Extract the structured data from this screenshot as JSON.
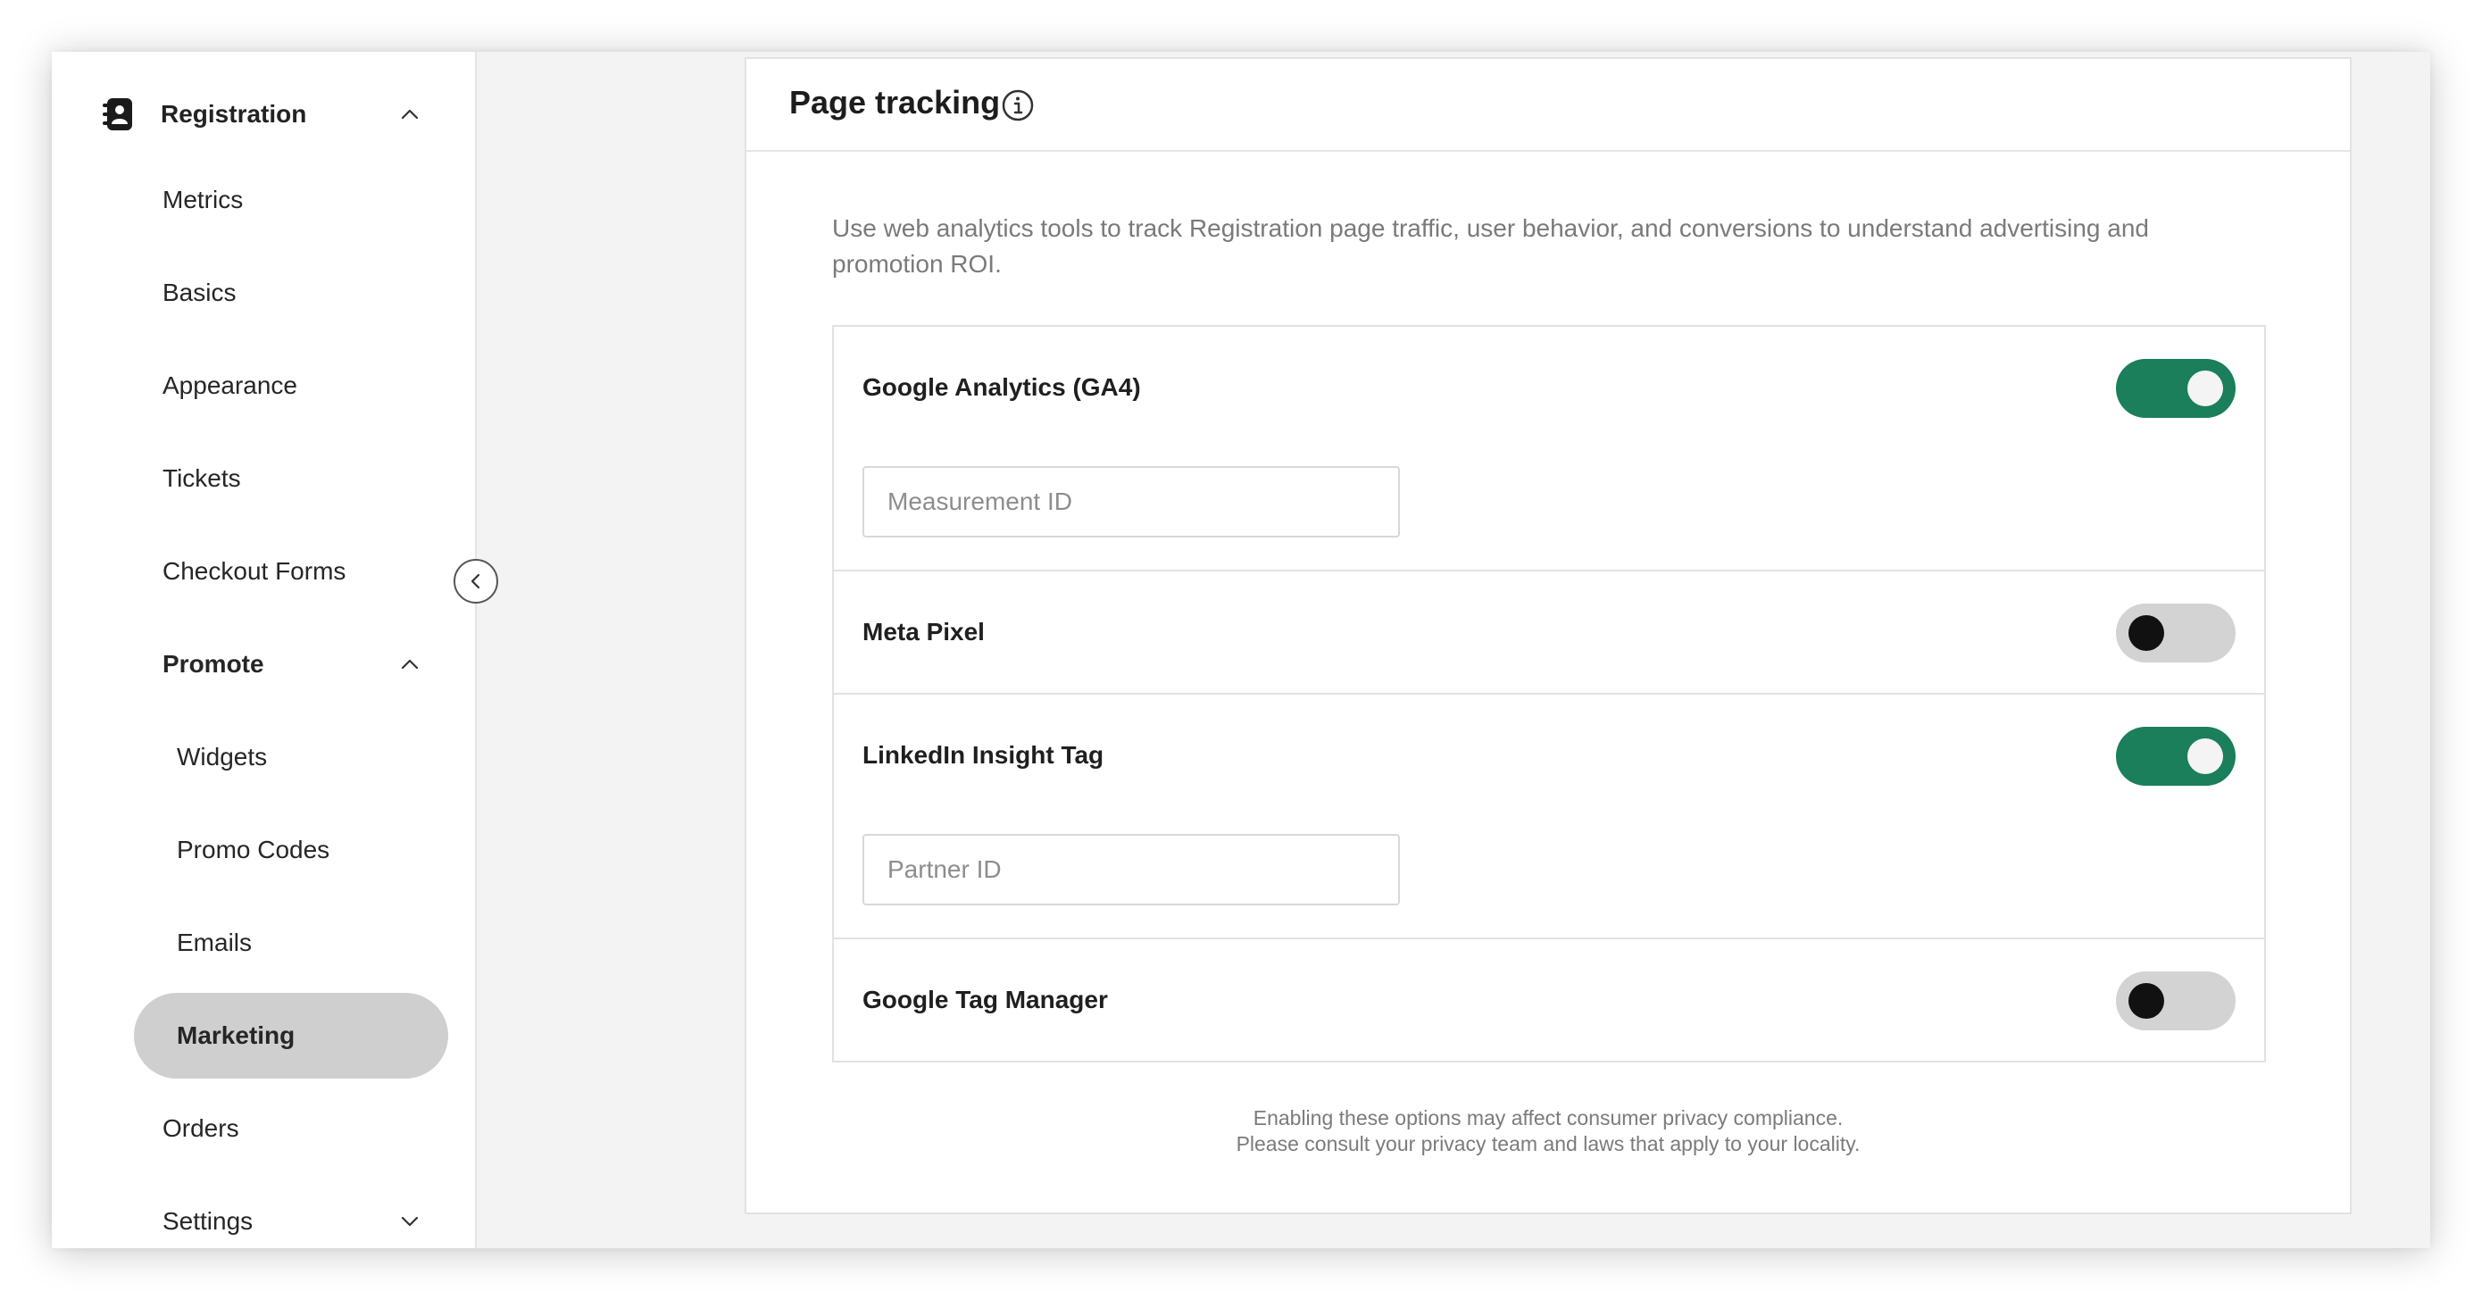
{
  "sidebar": {
    "header_label": "Registration",
    "items": [
      {
        "label": "Metrics"
      },
      {
        "label": "Basics"
      },
      {
        "label": "Appearance"
      },
      {
        "label": "Tickets"
      },
      {
        "label": "Checkout Forms"
      },
      {
        "label": "Promote"
      },
      {
        "label": "Widgets"
      },
      {
        "label": "Promo Codes"
      },
      {
        "label": "Emails"
      },
      {
        "label": "Marketing"
      },
      {
        "label": "Orders"
      },
      {
        "label": "Settings"
      }
    ],
    "active_item": "Marketing"
  },
  "main": {
    "title": "Page tracking",
    "description": "Use web analytics tools to track Registration page traffic, user behavior, and conversions to understand advertising and promotion ROI.",
    "trackers": [
      {
        "name": "Google Analytics (GA4)",
        "enabled": true,
        "field_placeholder": "Measurement ID",
        "field_value": ""
      },
      {
        "name": "Meta Pixel",
        "enabled": false
      },
      {
        "name": "LinkedIn Insight Tag",
        "enabled": true,
        "field_placeholder": "Partner ID",
        "field_value": ""
      },
      {
        "name": "Google Tag Manager",
        "enabled": false
      }
    ],
    "footnote_line1": "Enabling these options may affect consumer privacy compliance.",
    "footnote_line2": "Please consult your privacy team and laws that apply to your locality."
  },
  "colors": {
    "accent": "#1a7f5a",
    "active_nav_bg": "#cfcfcf",
    "toggle_off": "#d3d3d3"
  },
  "icons": {
    "app": "registration-app-icon",
    "collapse": "chevron-left-icon",
    "info": "info-icon"
  }
}
